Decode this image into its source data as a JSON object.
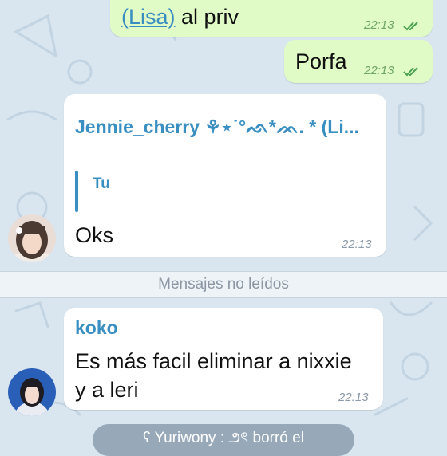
{
  "messages": {
    "top_out": {
      "mention": "(Lisa)",
      "text": "al priv",
      "time": "22:13"
    },
    "porfa": {
      "text": "Porfa",
      "time": "22:13"
    },
    "jennie": {
      "sender": "Jennie_cherry ⚘⋆˙°ᨒ*ᨏ. * (Li...",
      "reply_name": "Tu",
      "text": "Oks",
      "time": "22:13"
    },
    "koko": {
      "sender": "koko",
      "line1": "Es más facil eliminar a nixxie",
      "line2": "y a leri",
      "time": "22:13"
    }
  },
  "divider_label": "Mensajes no leídos",
  "service_message": "ʕ Yuriwony : ౨ৎ borró el",
  "colors": {
    "background": "#d9e6f0",
    "outgoing_bubble": "#e0fbc6",
    "incoming_bubble": "#ffffff",
    "accent": "#3a8fc2"
  }
}
